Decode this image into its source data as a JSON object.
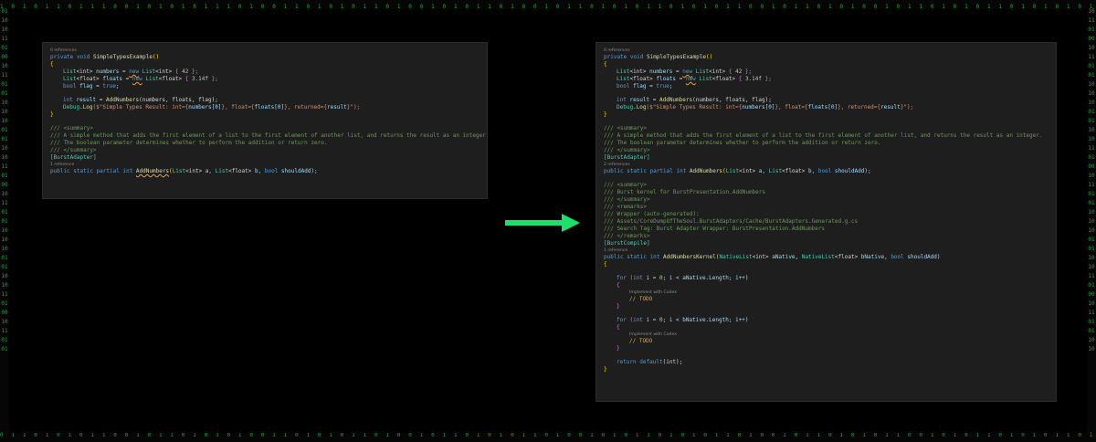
{
  "background": {
    "binary_top": "1 0 1 0 1 1 0 1 1 1 0 0 1 0 1 0 1 0 1 1 1 0 1 0 0 1 1 0 1 0 1 0 1 1 0 1 0 0 1 0 1 0 1 1 0 1 0 0 1 0 1 1 0 1 0 1 0 1 1 0 1 0 1 0 1 1 0 0 1 0 1 1 0 1 0 1 0 0 1 0 1 1 0 1 0 1 0 1 1 0 1 0 1 0 1 0 1 1 0 1 0 0 1 0 1 1 0 1 0 1 0 1 1 0 1 0 1 0 1 1 0 1 0 1 1 0 1 0 0 1 0 1 1 0 1 0 1 0 1 1 0 1 0 1 0 1 1 0 1 0 1 0 1 1 0 1 0 1 0 1 0 1 1 0 1 0 1 0",
    "binary_bottom": "0 1 1 0 1 0 1 0 1 1 0 0 1 0 1 1 0 1 0 1 0 1 0 0 1 1 0 1 0 1 0 1 1 0 1 0 0 1 0 1 1 0 1 0 1 0 1 1 0 1 0 0 1 0 1 0 1 1 0 1 0 1 0 1 1 0 1 0 0 1 0 1 1 0 1 0 1 0 1 1 0 0 1 0 1 0 1 1 0 1 0 1 0 1 1 0 1 0 1 0 1 1 0 1 0 0 1 0 1 1 0 1 0 1 0 1 0 1 1 0 1 0 1 0 1 1 0 1 0 0 1 0 1 1 0 1 0 1 0 1 1 0 1 0 1 0 1 1 0 1 0 1 0 1 0 1 1 0 1 0 1 0 1 1 0 1 0 1",
    "binary_left": "0110101101001011010110101001011010110100101101011010100101101011010010110101",
    "binary_right": "1011010010110101101010010110101101001011010110101001011010110100101101011010",
    "accent": "#21a63a"
  },
  "arrow": {
    "color": "#1be06a",
    "icon": "arrow-right-icon"
  },
  "left_panel": {
    "l1": "0 references",
    "l2a": "private void ",
    "l2b": "SimpleTypesExample",
    "l2c": "()",
    "l3": "{",
    "l4a": "List",
    "l4b": "<int>",
    "l4c": " numbers",
    "l4d": " = ",
    "l4e": "new",
    "l4f": " List",
    "l4g": "<int>",
    "l4h": " { ",
    "l4i": "42",
    "l4j": " };",
    "l5a": "List",
    "l5b": "<float>",
    "l5c": " floats",
    "l5d": " = ",
    "l5e": "new",
    "l5f": " List",
    "l5g": "<float>",
    "l5h": " { ",
    "l5i": "3.14f",
    "l5j": " };",
    "l6a": "bool",
    "l6b": " flag",
    "l6c": " = ",
    "l6d": "true",
    "l6e": ";",
    "l8a": "int",
    "l8b": " result",
    "l8c": " = ",
    "l8d": "AddNumbers",
    "l8e": "(numbers, floats, flag);",
    "l9a": "Debug",
    "l9b": ".",
    "l9c": "Log",
    "l9d": "($\"Simple Types Result: int={",
    "l9e": "numbers[0]",
    "l9f": "}, float={",
    "l9g": "floats[0]",
    "l9h": "}, returned={",
    "l9i": "result",
    "l9j": "}\");",
    "l10": "}",
    "l12": "/// <summary>",
    "l13": "/// A simple method that adds the first element of a list to the first element of another list, and returns the result as an integer.",
    "l14": "/// The boolean parameter determines whether to perform the addition or return zero.",
    "l15": "/// </summary>",
    "l16": "[BurstAdapter]",
    "l17": "1 reference",
    "l18a": "public static partial int ",
    "l18b": "AddNumbers",
    "l18c": "(",
    "l18d": "List",
    "l18e": "<int>",
    "l18f": " a, ",
    "l18g": "List",
    "l18h": "<float>",
    "l18i": " b, ",
    "l18j": "bool",
    "l18k": " shouldAdd);"
  },
  "right_panel": {
    "l1": "0 references",
    "l2a": "private void ",
    "l2b": "SimpleTypesExample",
    "l2c": "()",
    "l3": "{",
    "l4a": "List",
    "l4b": "<int>",
    "l4c": " numbers",
    "l4d": " = ",
    "l4e": "new",
    "l4f": " List",
    "l4g": "<int>",
    "l4h": " { ",
    "l4i": "42",
    "l4j": " };",
    "l5a": "List",
    "l5b": "<float>",
    "l5c": " floats",
    "l5d": " = ",
    "l5e": "new",
    "l5f": " List",
    "l5g": "<float>",
    "l5h": " { ",
    "l5i": "3.14f",
    "l5j": " };",
    "l6a": "bool",
    "l6b": " flag",
    "l6c": " = ",
    "l6d": "true",
    "l6e": ";",
    "l8a": "int",
    "l8b": " result",
    "l8c": " = ",
    "l8d": "AddNumbers",
    "l8e": "(numbers, floats, flag);",
    "l9a": "Debug",
    "l9b": ".",
    "l9c": "Log",
    "l9d": "($\"Simple Types Result: int={",
    "l9e": "numbers[0]",
    "l9f": "}, float={",
    "l9g": "floats[0]",
    "l9h": "}, returned={",
    "l9i": "result",
    "l9j": "}\");",
    "l10": "}",
    "l12": "/// <summary>",
    "l13": "/// A simple method that adds the first element of a list to the first element of another list, and returns the result as an integer.",
    "l14": "/// The boolean parameter determines whether to perform the addition or return zero.",
    "l15": "/// </summary>",
    "l16": "[BurstAdapter]",
    "l17": "2 references",
    "l18a": "public static partial int ",
    "l18b": "AddNumbers",
    "l18c": "(",
    "l18d": "List",
    "l18e": "<int>",
    "l18f": " a, ",
    "l18g": "List",
    "l18h": "<float>",
    "l18i": " b, ",
    "l18j": "bool",
    "l18k": " shouldAdd);",
    "l20": "/// <summary>",
    "l21": "/// Burst kernel for BurstPresentation.AddNumbers",
    "l22": "/// </summary>",
    "l23": "/// <remarks>",
    "l24": "/// Wrapper (auto-generated):",
    "l25": "/// Assets/CoreDumpOfTheSoul.BurstAdapters/Cache/BurstAdapters.Generated.g.cs",
    "l26": "/// Search Tag: Burst Adapter Wrapper: BurstPresentation.AddNumbers",
    "l27": "/// </remarks>",
    "l28": "[BurstCompile]",
    "l29": "1 reference",
    "l30a": "public static int ",
    "l30b": "AddNumbersKernel",
    "l30c": "(",
    "l30d": "NativeList",
    "l30e": "<int>",
    "l30f": " aNative, ",
    "l30g": "NativeList",
    "l30h": "<float>",
    "l30i": " bNative, ",
    "l30j": "bool",
    "l30k": " shouldAdd)",
    "l31": "{",
    "l33a": "for",
    "l33b": " (",
    "l33c": "int",
    "l33d": " i = ",
    "l33e": "0",
    "l33f": "; i < aNative.Length; i++)",
    "l34": "{",
    "l35": "Implement with Codex",
    "l36": "// TODO",
    "l37": "}",
    "l39a": "for",
    "l39b": " (",
    "l39c": "int",
    "l39d": " i = ",
    "l39e": "0",
    "l39f": "; i < bNative.Length; i++)",
    "l40": "{",
    "l41": "Implement with Codex",
    "l42": "// TODO",
    "l43": "}",
    "l45a": "return",
    "l45b": " default",
    "l45c": "(int);",
    "l46": "}"
  }
}
